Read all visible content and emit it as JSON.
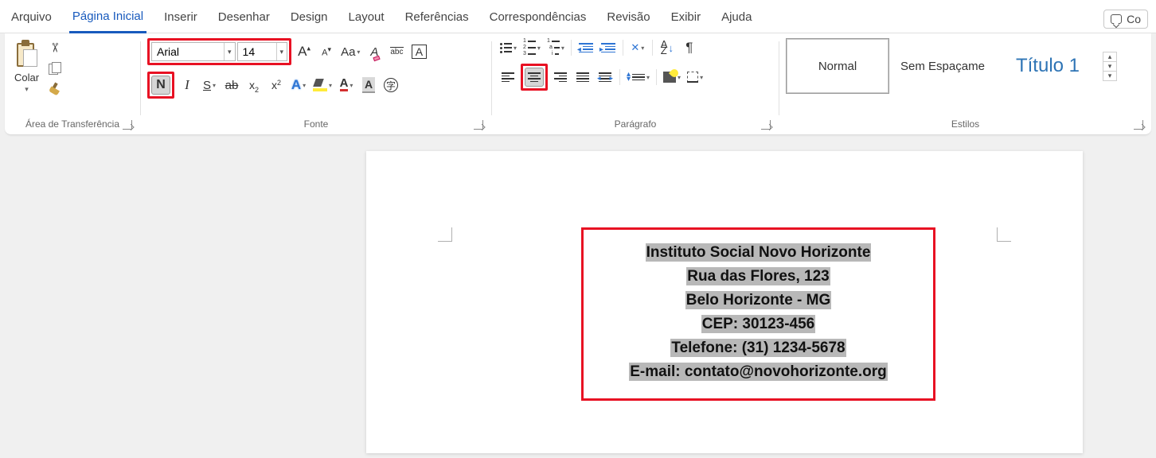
{
  "menu": {
    "items": [
      "Arquivo",
      "Página Inicial",
      "Inserir",
      "Desenhar",
      "Design",
      "Layout",
      "Referências",
      "Correspondências",
      "Revisão",
      "Exibir",
      "Ajuda"
    ],
    "active_index": 1,
    "right_label": "Co"
  },
  "ribbon": {
    "clipboard": {
      "paste_label": "Colar",
      "group_label": "Área de Transferência"
    },
    "font": {
      "font_name": "Arial",
      "font_size": "14",
      "group_label": "Fonte",
      "bold_glyph": "N",
      "italic_glyph": "I",
      "underline_glyph": "S",
      "strike_glyph": "ab",
      "sub_glyph": "x",
      "sup_glyph": "x",
      "effect_glyph": "A",
      "fontcolor_glyph": "A",
      "shade_glyph": "A",
      "border_glyph": "A",
      "grow_glyph": "A",
      "shrink_glyph": "A",
      "case_glyph": "Aa",
      "clear_glyph": "A"
    },
    "paragraph": {
      "group_label": "Parágrafo",
      "sort_a": "A",
      "sort_z": "Z",
      "pilcrow": "¶"
    },
    "styles": {
      "group_label": "Estilos",
      "items": [
        {
          "label": "Normal",
          "cls": "active"
        },
        {
          "label": "Sem Espaçame",
          "cls": "noborder"
        },
        {
          "label": "Título 1",
          "cls": "title1 noborder"
        }
      ]
    }
  },
  "document": {
    "lines": [
      "Instituto Social Novo Horizonte",
      "Rua das Flores, 123",
      "Belo Horizonte - MG",
      "CEP: 30123-456",
      "Telefone: (31) 1234-5678",
      "E-mail: contato@novohorizonte.org"
    ]
  }
}
